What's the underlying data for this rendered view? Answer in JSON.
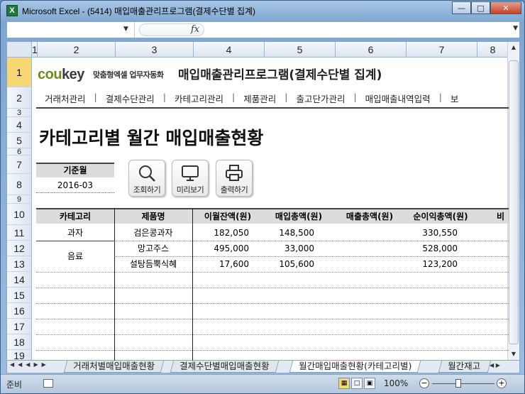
{
  "window": {
    "title": "Microsoft Excel - (5414) 매입매출관리프로그램(결제수단별 집계)",
    "app_icon": "X"
  },
  "formula_bar": {
    "name_box": "",
    "fx": "fx",
    "content": ""
  },
  "columns": [
    "1",
    "2",
    "3",
    "4",
    "5",
    "6",
    "7",
    "8"
  ],
  "rows": [
    "1",
    "2",
    "3",
    "4",
    "5",
    "6",
    "7",
    "8",
    "9",
    "10",
    "11",
    "12",
    "13",
    "14",
    "15",
    "16",
    "17",
    "18",
    "19"
  ],
  "brand": {
    "logo_main": "cou",
    "logo_key": "key",
    "logo_sub": "맞춤형엑셀 업무자동화"
  },
  "app_title": "매입매출관리프로그램(결제수단별 집계)",
  "menu": [
    "거래처관리",
    "결제수단관리",
    "카테고리관리",
    "제품관리",
    "출고단가관리",
    "매입매출내역입력",
    "보"
  ],
  "page_title": "카테고리별 월간 매입매출현황",
  "base": {
    "label": "기준월",
    "value": "2016-03"
  },
  "buttons": {
    "search": "조회하기",
    "preview": "미리보기",
    "print": "출력하기"
  },
  "table": {
    "headers": [
      "카테고리",
      "제품명",
      "이월잔액(원)",
      "매입총액(원)",
      "매출총액(원)",
      "순이익총액(원)",
      "비"
    ],
    "rows": [
      {
        "category": "과자",
        "product": "검은콩과자",
        "carry": "182,050",
        "purchase": "148,500",
        "sales": "",
        "profit": "330,550"
      },
      {
        "category": "음료",
        "product": "망고주스",
        "carry": "495,000",
        "purchase": "33,000",
        "sales": "",
        "profit": "528,000"
      },
      {
        "category": "",
        "product": "설탕듬뿍식혜",
        "carry": "17,600",
        "purchase": "105,600",
        "sales": "",
        "profit": "123,200"
      }
    ]
  },
  "sheet_tabs": [
    "거래처별매입매출현황",
    "결제수단별매입매출현황",
    "월간매입매출현황(카테고리별)",
    "월간재고"
  ],
  "status": {
    "ready": "준비",
    "zoom": "100%"
  }
}
